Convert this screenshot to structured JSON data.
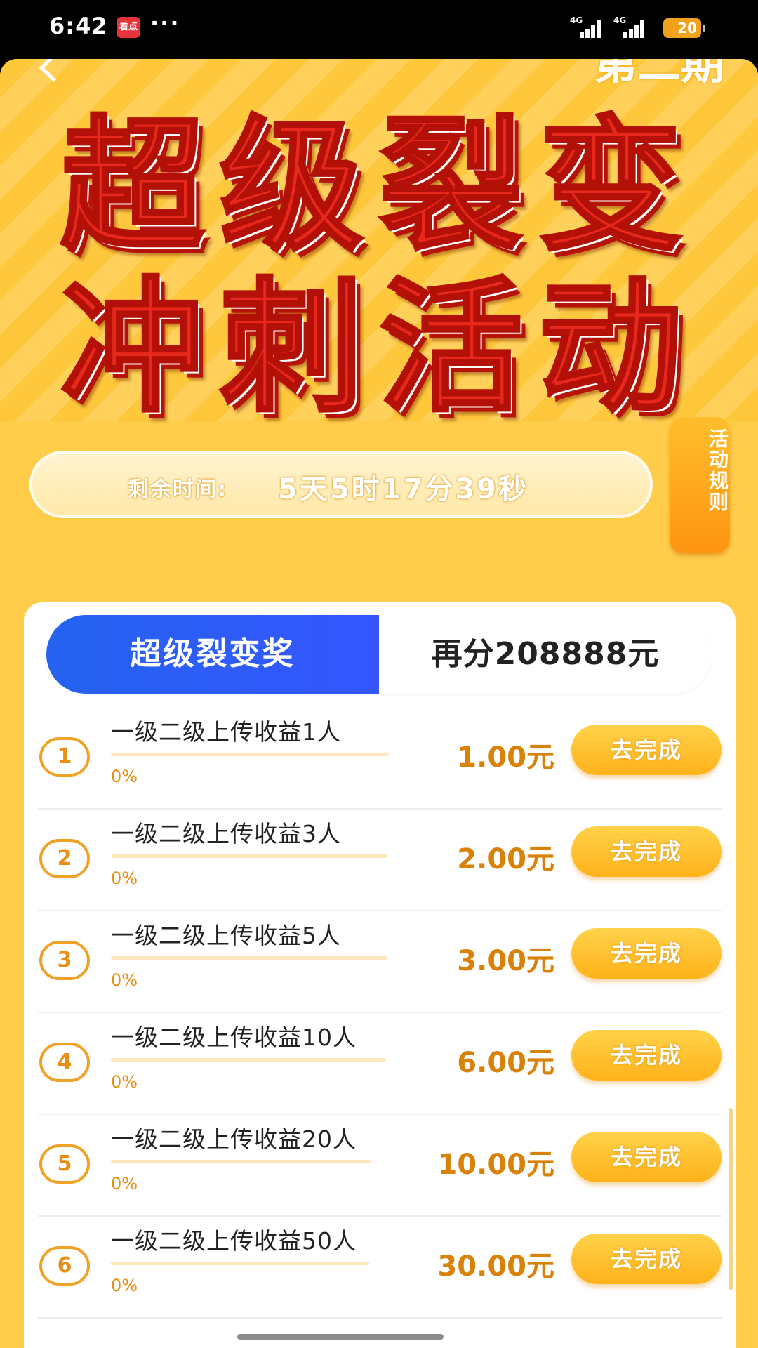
{
  "status_bar": {
    "time": "6:42",
    "app_icon": "看点",
    "dots": "···",
    "signal1": "4G",
    "signal2": "4G",
    "battery": "20"
  },
  "header": {
    "period": "第二期",
    "title_line1": "超级裂变",
    "title_line2": "冲刺活动"
  },
  "timer": {
    "label": "剩余时间:",
    "value": "5天5时17分39秒"
  },
  "rules_button": "活动规则",
  "tabs": {
    "active": "超级裂变奖",
    "right": "再分208888元"
  },
  "tasks": [
    {
      "num": "1",
      "title": "一级二级上传收益1人",
      "progress": "0%",
      "progress_value": 0,
      "reward": "1.00元",
      "button": "去完成"
    },
    {
      "num": "2",
      "title": "一级二级上传收益3人",
      "progress": "0%",
      "progress_value": 0,
      "reward": "2.00元",
      "button": "去完成"
    },
    {
      "num": "3",
      "title": "一级二级上传收益5人",
      "progress": "0%",
      "progress_value": 0,
      "reward": "3.00元",
      "button": "去完成"
    },
    {
      "num": "4",
      "title": "一级二级上传收益10人",
      "progress": "0%",
      "progress_value": 0,
      "reward": "6.00元",
      "button": "去完成"
    },
    {
      "num": "5",
      "title": "一级二级上传收益20人",
      "progress": "0%",
      "progress_value": 0,
      "reward": "10.00元",
      "button": "去完成"
    },
    {
      "num": "6",
      "title": "一级二级上传收益50人",
      "progress": "0%",
      "progress_value": 0,
      "reward": "30.00元",
      "button": "去完成"
    }
  ],
  "colors": {
    "accent_blue": "#2563f0",
    "accent_orange": "#e88e12",
    "title_red": "#e8281c",
    "background_yellow": "#ffcd4a"
  }
}
